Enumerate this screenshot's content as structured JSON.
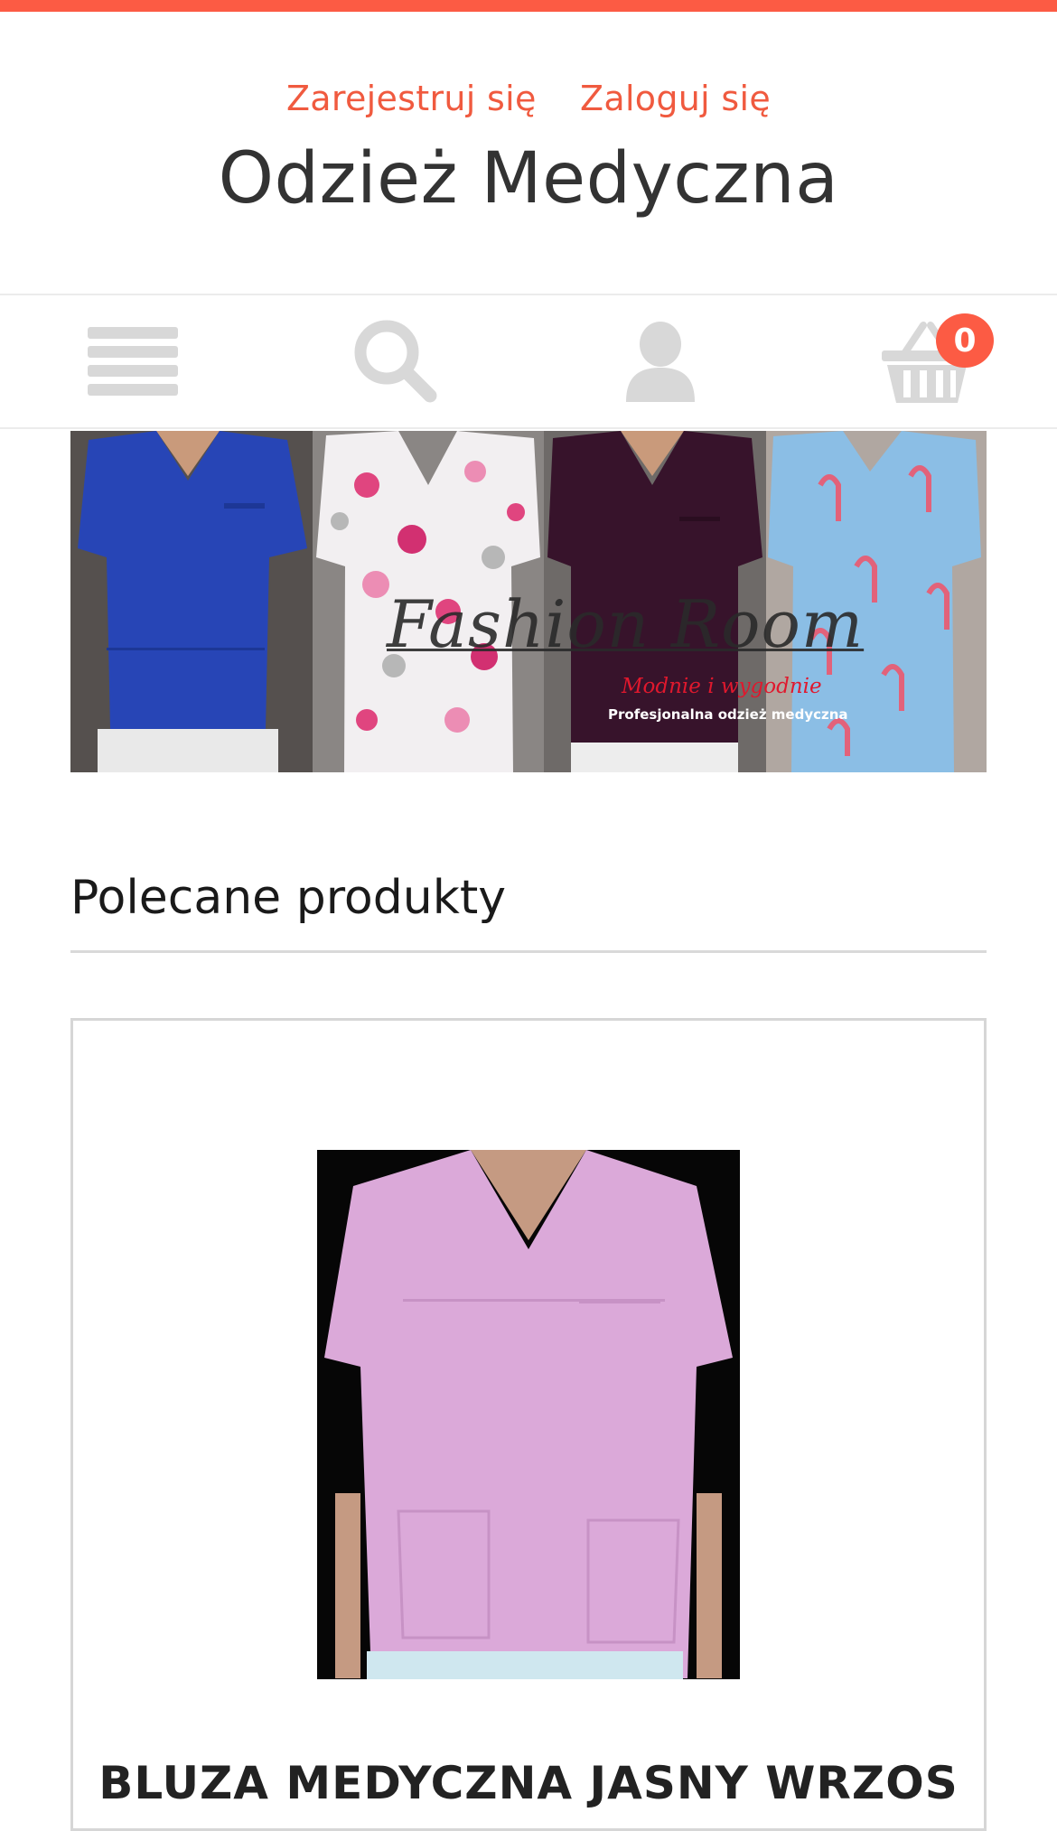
{
  "header": {
    "register_label": "Zarejestruj się",
    "login_label": "Zaloguj się",
    "site_title": "Odzież Medyczna"
  },
  "nav": {
    "menu_icon": "menu-icon",
    "search_icon": "search-icon",
    "account_icon": "user-icon",
    "cart_icon": "basket-icon",
    "cart_count": "0"
  },
  "banner": {
    "brand": "Fashion Room",
    "slogan": "Modnie i wygodnie",
    "tagline": "Profesjonalna odzież medyczna"
  },
  "featured": {
    "title": "Polecane produkty",
    "products": [
      {
        "name": "BLUZA MEDYCZNA JASNY WRZOS"
      }
    ]
  },
  "colors": {
    "accent": "#fc5b44",
    "link": "#f05a3f",
    "icon_gray": "#d8d8d8"
  }
}
